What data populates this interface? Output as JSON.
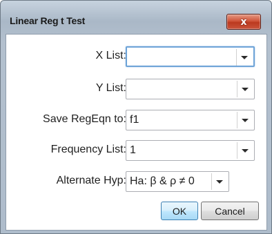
{
  "window": {
    "title": "Linear Reg t Test",
    "close_glyph": "x"
  },
  "fields": [
    {
      "label": "X List:",
      "value": ""
    },
    {
      "label": "Y List:",
      "value": ""
    },
    {
      "label": "Save RegEqn to:",
      "value": "f1"
    },
    {
      "label": "Frequency List:",
      "value": "1"
    },
    {
      "label": "Alternate Hyp:",
      "value": "Ha: β & ρ ≠ 0"
    }
  ],
  "buttons": {
    "ok": "OK",
    "cancel": "Cancel"
  },
  "colors": {
    "close_button": "#c9452a",
    "focus_ring": "#6da3d7",
    "ok_button": "#bee6fd"
  }
}
